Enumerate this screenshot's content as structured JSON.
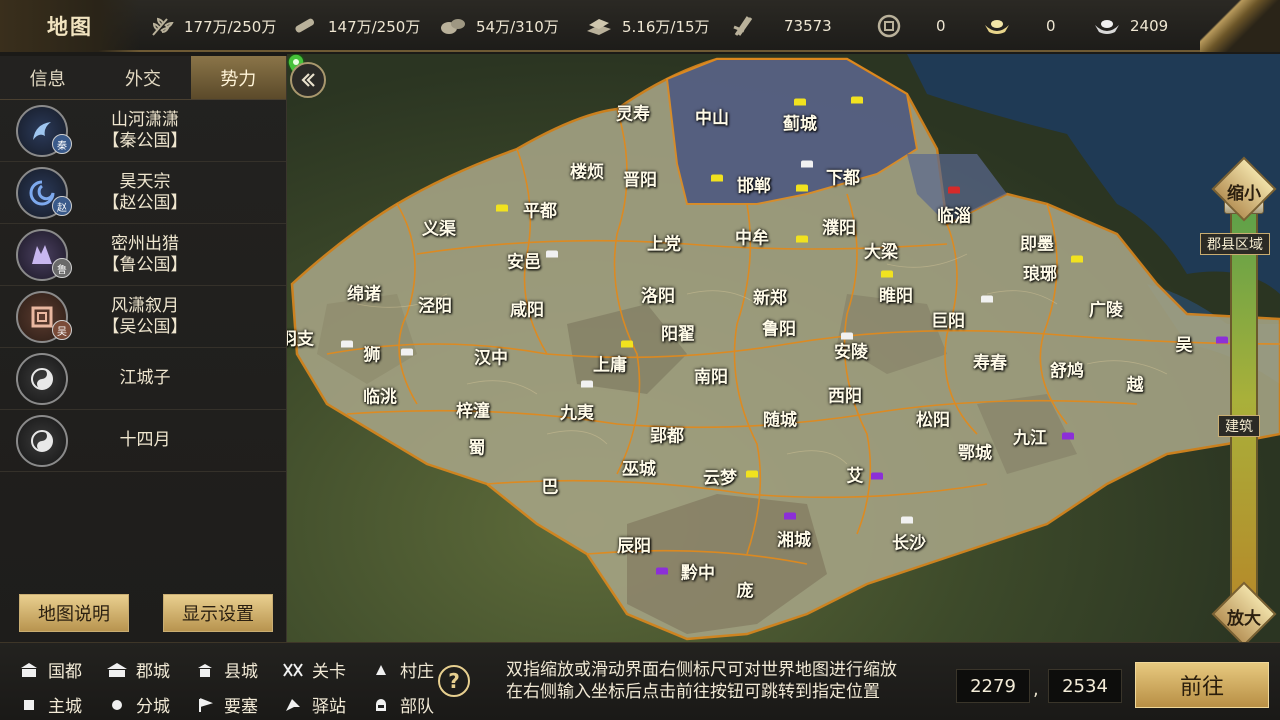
{
  "header": {
    "title": "地图",
    "resources": [
      {
        "icon": "grain-icon",
        "value": "177万/250万"
      },
      {
        "icon": "wood-icon",
        "value": "147万/250万"
      },
      {
        "icon": "stone-icon",
        "value": "54万/310万"
      },
      {
        "icon": "iron-icon",
        "value": "5.16万/15万"
      },
      {
        "icon": "decree-icon",
        "value": "73573"
      },
      {
        "icon": "copper-coin-icon",
        "value": "0"
      },
      {
        "icon": "gold-ingot-icon",
        "value": "0"
      },
      {
        "icon": "silver-ingot-icon",
        "value": "2409"
      }
    ]
  },
  "sidebar": {
    "tabs": [
      {
        "label": "信息",
        "active": false
      },
      {
        "label": "外交",
        "active": false
      },
      {
        "label": "势力",
        "active": true
      }
    ],
    "factions": [
      {
        "name": "山河潇潇",
        "title": "【秦公国】",
        "badge": "秦",
        "emblem": "dragon-emblem-icon"
      },
      {
        "name": "昊天宗",
        "title": "【赵公国】",
        "badge": "赵",
        "emblem": "swirl-emblem-icon"
      },
      {
        "name": "密州出猎",
        "title": "【鲁公国】",
        "badge": "鲁",
        "emblem": "beast-emblem-icon"
      },
      {
        "name": "风潇叙月",
        "title": "【吴公国】",
        "badge": "吴",
        "emblem": "knot-emblem-icon"
      },
      {
        "name": "江城子",
        "title": "",
        "badge": "",
        "emblem": "default-emblem-icon"
      },
      {
        "name": "十四月",
        "title": "",
        "badge": "",
        "emblem": "default-emblem-icon"
      }
    ],
    "map_legend_button": "地图说明",
    "display_settings_button": "显示设置"
  },
  "map": {
    "cities": [
      {
        "name": "灵寿"
      },
      {
        "name": "中山"
      },
      {
        "name": "蓟城"
      },
      {
        "name": "楼烦"
      },
      {
        "name": "晋阳"
      },
      {
        "name": "邯郸"
      },
      {
        "name": "下都"
      },
      {
        "name": "平都"
      },
      {
        "name": "临淄"
      },
      {
        "name": "义渠"
      },
      {
        "name": "上党"
      },
      {
        "name": "中牟"
      },
      {
        "name": "濮阳"
      },
      {
        "name": "即墨"
      },
      {
        "name": "安邑"
      },
      {
        "name": "大梁"
      },
      {
        "name": "琅琊"
      },
      {
        "name": "绵诸"
      },
      {
        "name": "泾阳"
      },
      {
        "name": "咸阳"
      },
      {
        "name": "洛阳"
      },
      {
        "name": "新郑"
      },
      {
        "name": "睢阳"
      },
      {
        "name": "广陵"
      },
      {
        "name": "巨阳"
      },
      {
        "name": "阳翟"
      },
      {
        "name": "鲁阳"
      },
      {
        "name": "吴"
      },
      {
        "name": "羽支"
      },
      {
        "name": "狮"
      },
      {
        "name": "汉中"
      },
      {
        "name": "上庸"
      },
      {
        "name": "南阳"
      },
      {
        "name": "安陵"
      },
      {
        "name": "寿春"
      },
      {
        "name": "舒鸠"
      },
      {
        "name": "临洮"
      },
      {
        "name": "梓潼"
      },
      {
        "name": "九夷"
      },
      {
        "name": "西阳"
      },
      {
        "name": "越"
      },
      {
        "name": "随城"
      },
      {
        "name": "松阳"
      },
      {
        "name": "九江"
      },
      {
        "name": "郢都"
      },
      {
        "name": "蜀"
      },
      {
        "name": "鄂城"
      },
      {
        "name": "巫城"
      },
      {
        "name": "云梦"
      },
      {
        "name": "艾"
      },
      {
        "name": "巴"
      },
      {
        "name": "湘城"
      },
      {
        "name": "长沙"
      },
      {
        "name": "辰阳"
      },
      {
        "name": "黔中"
      },
      {
        "name": "庞"
      }
    ]
  },
  "zoom": {
    "zoom_out_label": "缩小",
    "zoom_in_label": "放大",
    "region_tag": "郡县区域",
    "building_tag": "建筑"
  },
  "legend": [
    {
      "icon": "capital-icon",
      "label": "国都"
    },
    {
      "icon": "prefecture-city-icon",
      "label": "郡城"
    },
    {
      "icon": "county-city-icon",
      "label": "县城"
    },
    {
      "icon": "pass-icon",
      "label": "关卡"
    },
    {
      "icon": "village-icon",
      "label": "村庄"
    },
    {
      "icon": "main-city-icon",
      "label": "主城"
    },
    {
      "icon": "branch-city-icon",
      "label": "分城"
    },
    {
      "icon": "fortress-icon",
      "label": "要塞"
    },
    {
      "icon": "post-station-icon",
      "label": "驿站"
    },
    {
      "icon": "troop-icon",
      "label": "部队"
    }
  ],
  "footer": {
    "hint_line1": "双指缩放或滑动界面右侧标尺可对世界地图进行缩放",
    "hint_line2": "在右侧输入坐标后点击前往按钮可跳转到指定位置",
    "coord_x": "2279",
    "coord_separator": ",",
    "coord_y": "2534",
    "go_button": "前往"
  }
}
